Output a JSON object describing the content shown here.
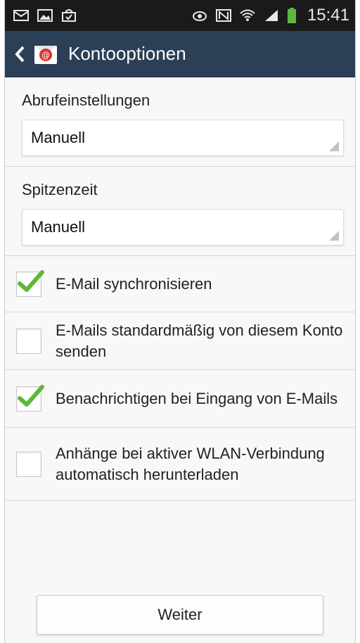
{
  "status_bar": {
    "time": "15:41",
    "left_icons": [
      "message-icon",
      "image-icon",
      "shopping-bag-icon"
    ],
    "right_icons": [
      "eye-icon",
      "nfc-icon",
      "wifi-icon",
      "signal-icon",
      "battery-icon"
    ]
  },
  "action_bar": {
    "title": "Kontooptionen",
    "back_icon": "chevron-left-icon",
    "app_icon": "email-app-icon"
  },
  "settings": {
    "fetch": {
      "label": "Abrufeinstellungen",
      "value": "Manuell"
    },
    "peak": {
      "label": "Spitzenzeit",
      "value": "Manuell"
    }
  },
  "options": [
    {
      "label": "E-Mail synchronisieren",
      "checked": true
    },
    {
      "label": "E-Mails standardmäßig von diesem Konto senden",
      "checked": false
    },
    {
      "label": "Benachrichtigen bei Eingang von E-Mails",
      "checked": true
    },
    {
      "label": "Anhänge bei aktiver WLAN-Verbindung automatisch herunterladen",
      "checked": false
    }
  ],
  "footer": {
    "next_label": "Weiter"
  },
  "colors": {
    "action_bar": "#2b3f57",
    "status_bar": "#1a1a1a",
    "check_green": "#5cb83a",
    "background": "#f8f8f8"
  }
}
